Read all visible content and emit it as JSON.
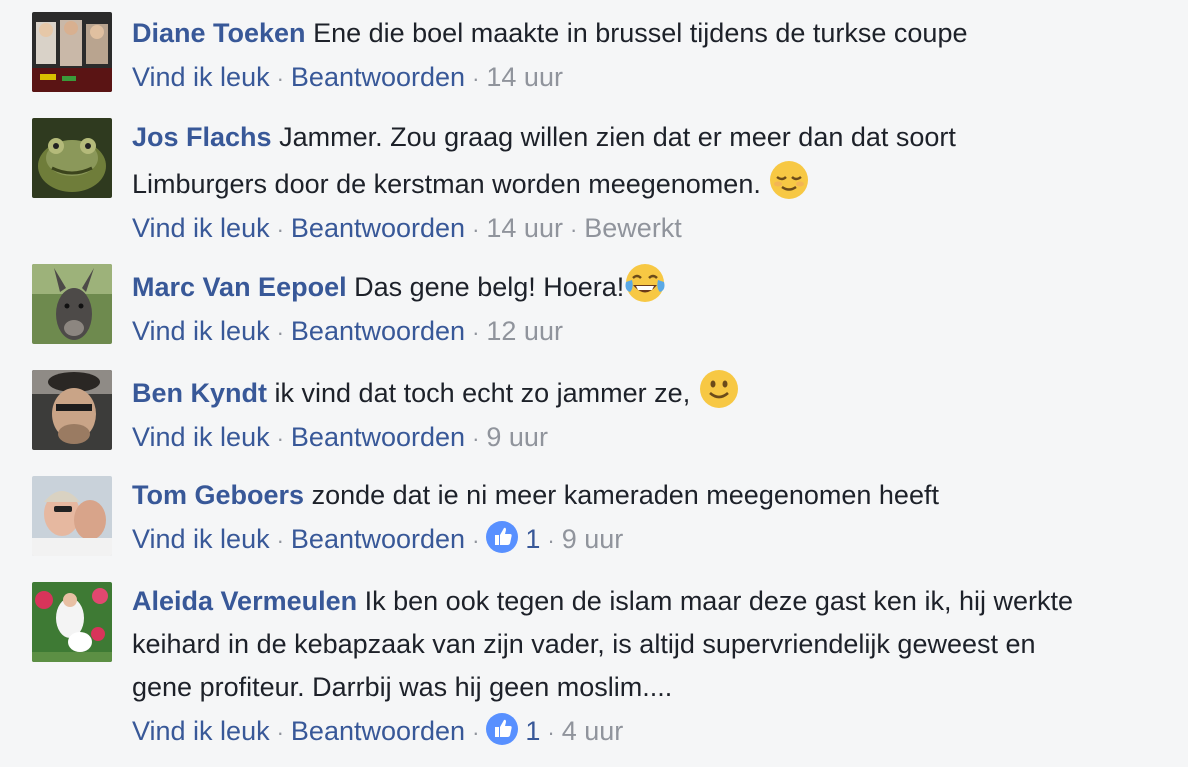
{
  "comments": [
    {
      "author": "Diane Toeken",
      "text": "Ene die boel maakte in brussel tijdens de turkse coupe",
      "like_label": "Vind ik leuk",
      "reply_label": "Beantwoorden",
      "time": "14 uur"
    },
    {
      "author": "Jos Flachs",
      "text_line1": "Jammer. Zou graag willen zien dat er meer dan dat soort",
      "text_line2": "Limburgers door de kerstman worden meegenomen.",
      "emoji": "relieved-face-emoji",
      "like_label": "Vind ik leuk",
      "reply_label": "Beantwoorden",
      "time": "14 uur",
      "edited_label": "Bewerkt"
    },
    {
      "author": "Marc Van Eepoel",
      "text": "Das gene belg! Hoera!",
      "emoji": "tears-of-joy-emoji",
      "like_label": "Vind ik leuk",
      "reply_label": "Beantwoorden",
      "time": "12 uur"
    },
    {
      "author": "Ben Kyndt",
      "text": "ik vind dat toch echt zo jammer ze,",
      "emoji": "slightly-smiling-face-emoji",
      "like_label": "Vind ik leuk",
      "reply_label": "Beantwoorden",
      "time": "9 uur"
    },
    {
      "author": "Tom Geboers",
      "text": "zonde dat ie ni meer kameraden meegenomen heeft",
      "like_label": "Vind ik leuk",
      "reply_label": "Beantwoorden",
      "reactions": "1",
      "time": "9 uur"
    },
    {
      "author": "Aleida Vermeulen",
      "text_line1": "Ik ben ook tegen de islam maar deze gast ken ik, hij werkte",
      "text_line2": "keihard in de kebapzaak van zijn vader, is altijd supervriendelijk geweest en",
      "text_line3": "gene profiteur. Darrbij was hij geen moslim....",
      "like_label": "Vind ik leuk",
      "reply_label": "Beantwoorden",
      "reactions": "1",
      "time": "4 uur"
    }
  ],
  "separator": "·",
  "colors": {
    "author_link": "#385898",
    "meta": "#90949c",
    "text": "#1d2129",
    "background": "#f5f6f7",
    "like_badge": "#5890ff"
  }
}
